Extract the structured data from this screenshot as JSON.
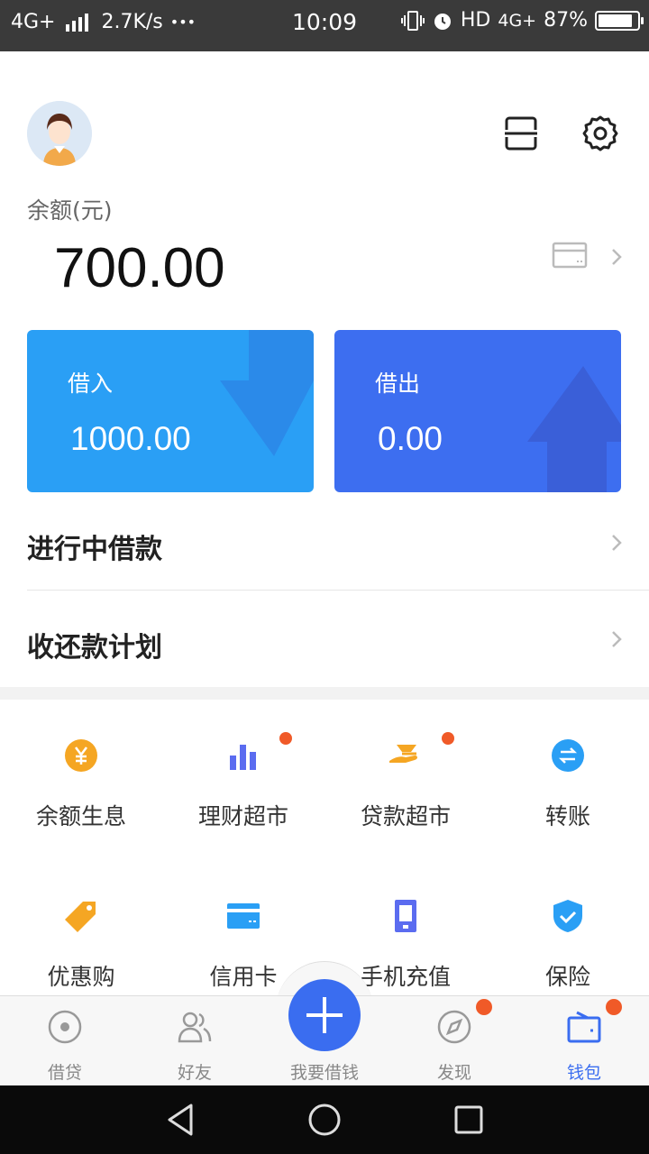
{
  "status_bar": {
    "network": "4G+",
    "speed": "2.7K/s",
    "more": "•••",
    "time": "10:09",
    "hd": "HD",
    "network2": "4G+",
    "battery": "87%",
    "battery_level": 0.87
  },
  "header": {
    "avatar_icon": "user-avatar-icon",
    "scan_icon": "scan-icon",
    "settings_icon": "gear-icon"
  },
  "balance": {
    "label": "余额(元)",
    "amount": "700.00",
    "card_icon": "bank-card-icon"
  },
  "cards": {
    "borrow_in": {
      "label": "借入",
      "value": "1000.00",
      "color": "#2a9ff5"
    },
    "borrow_out": {
      "label": "借出",
      "value": "0.00",
      "color": "#3d6ef0"
    }
  },
  "list": {
    "ongoing": "进行中借款",
    "plan": "收还款计划"
  },
  "grid": [
    {
      "label": "余额生息",
      "icon": "yuan-coin-icon",
      "color": "#f5a623"
    },
    {
      "label": "理财超市",
      "icon": "bar-chart-icon",
      "color": "#5b6cf0"
    },
    {
      "label": "贷款超市",
      "icon": "hand-money-icon",
      "color": "#f5a623"
    },
    {
      "label": "转账",
      "icon": "transfer-icon",
      "color": "#2a9ff5"
    },
    {
      "label": "优惠购",
      "icon": "tag-icon",
      "color": "#f5a623"
    },
    {
      "label": "信用卡",
      "icon": "credit-card-icon",
      "color": "#2a9ff5"
    },
    {
      "label": "手机充值",
      "icon": "phone-icon",
      "color": "#5b6cf0"
    },
    {
      "label": "保险",
      "icon": "shield-icon",
      "color": "#2a9ff5"
    }
  ],
  "tabs": [
    {
      "label": "借贷",
      "icon": "loan-icon"
    },
    {
      "label": "好友",
      "icon": "friends-icon"
    },
    {
      "label": "我要借钱",
      "icon": "plus-icon"
    },
    {
      "label": "发现",
      "icon": "compass-icon"
    },
    {
      "label": "钱包",
      "icon": "wallet-icon"
    }
  ],
  "colors": {
    "accent": "#3a6df0",
    "badge": "#f05a28"
  }
}
